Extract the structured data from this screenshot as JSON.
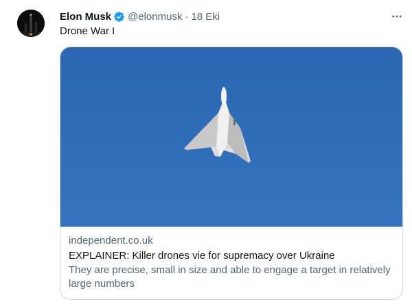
{
  "tweet": {
    "author": {
      "name": "Elon Musk",
      "handle": "@elonmusk",
      "verified": true
    },
    "separator": "·",
    "date": "18 Eki",
    "text": "Drone War I",
    "more_icon": "more-horizontal-icon"
  },
  "card": {
    "domain": "independent.co.uk",
    "title": "EXPLAINER: Killer drones vie for supremacy over Ukraine",
    "description": "They are precise, small in size and able to engage a target in relatively large numbers"
  },
  "colors": {
    "verified_badge": "#1d9bf0",
    "sky": "#2f6bb6",
    "secondary_text": "#536471"
  }
}
